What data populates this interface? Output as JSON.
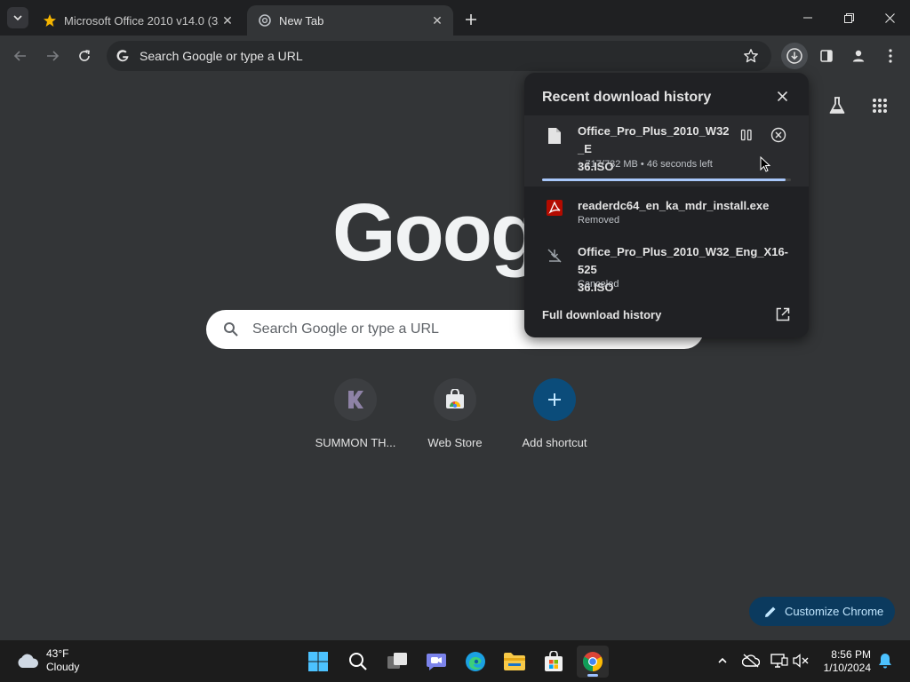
{
  "tabs": [
    {
      "title": "Microsoft Office 2010 v14.0 (32...",
      "favicon": "star-icon",
      "active": false
    },
    {
      "title": "New Tab",
      "favicon": "chrome-icon",
      "active": true
    }
  ],
  "toolbar": {
    "omnibox_text": "Search Google or type a URL"
  },
  "ntp": {
    "logo_text": "Goog",
    "search_placeholder": "Search Google or type a URL",
    "shortcuts": [
      {
        "label": "SUMMON TH...",
        "icon": "k-logo-icon"
      },
      {
        "label": "Web Store",
        "icon": "web-store-icon"
      },
      {
        "label": "Add shortcut",
        "icon": "plus-icon"
      }
    ],
    "customize_label": "Customize Chrome"
  },
  "downloads": {
    "title": "Recent download history",
    "items": [
      {
        "name": "Office_Pro_Plus_2010_W32_E36.ISO",
        "name_line1": "Office_Pro_Plus_2010_W32_E",
        "name_line2": "36.ISO",
        "status": "↓ 717/732 MB • 46 seconds left",
        "progress": 0.98,
        "icon": "file-icon"
      },
      {
        "name": "readerdc64_en_ka_mdr_install.exe",
        "status": "Removed",
        "icon": "adobe-pdf-icon"
      },
      {
        "name_line1": "Office_Pro_Plus_2010_W32_Eng_X16-525",
        "name_line2": "36.ISO",
        "status": "Canceled",
        "icon": "download-off-icon"
      }
    ],
    "full_history_label": "Full download history"
  },
  "taskbar": {
    "weather_temp": "43°F",
    "weather_desc": "Cloudy",
    "time": "8:56 PM",
    "date": "1/10/2024"
  },
  "colors": {
    "accent": "#a8c7fa",
    "background": "#333537",
    "bubble": "#202124"
  }
}
